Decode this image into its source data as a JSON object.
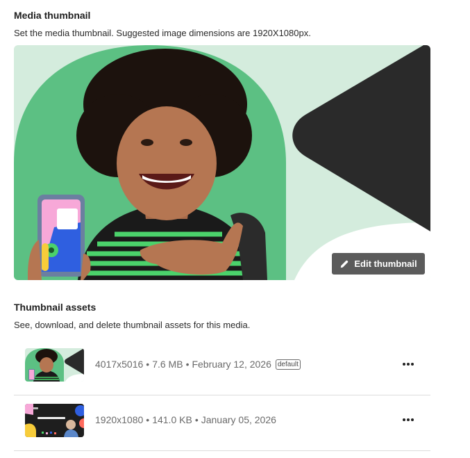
{
  "media_thumbnail": {
    "title": "Media thumbnail",
    "description": "Set the media thumbnail. Suggested image dimensions are 1920X1080px.",
    "edit_button_label": "Edit thumbnail"
  },
  "thumbnail_assets": {
    "title": "Thumbnail assets",
    "description": "See, download, and delete thumbnail assets for this media.",
    "items": [
      {
        "dimensions": "4017x5016",
        "size": "7.6 MB",
        "date": "February 12, 2026",
        "badge": "default",
        "image": "portrait-photo"
      },
      {
        "dimensions": "1920x1080",
        "size": "141.0 KB",
        "date": "January 05, 2026",
        "image": "slide-preview"
      }
    ]
  },
  "colors": {
    "brand_green": "#5cc083",
    "mint_background": "#d4ecdd",
    "dark_triangle": "#2a2a2a",
    "button_gray": "#5b5b5b"
  },
  "icons": {
    "edit_button": "pencil-icon",
    "row_menu": "more-horizontal-icon"
  }
}
